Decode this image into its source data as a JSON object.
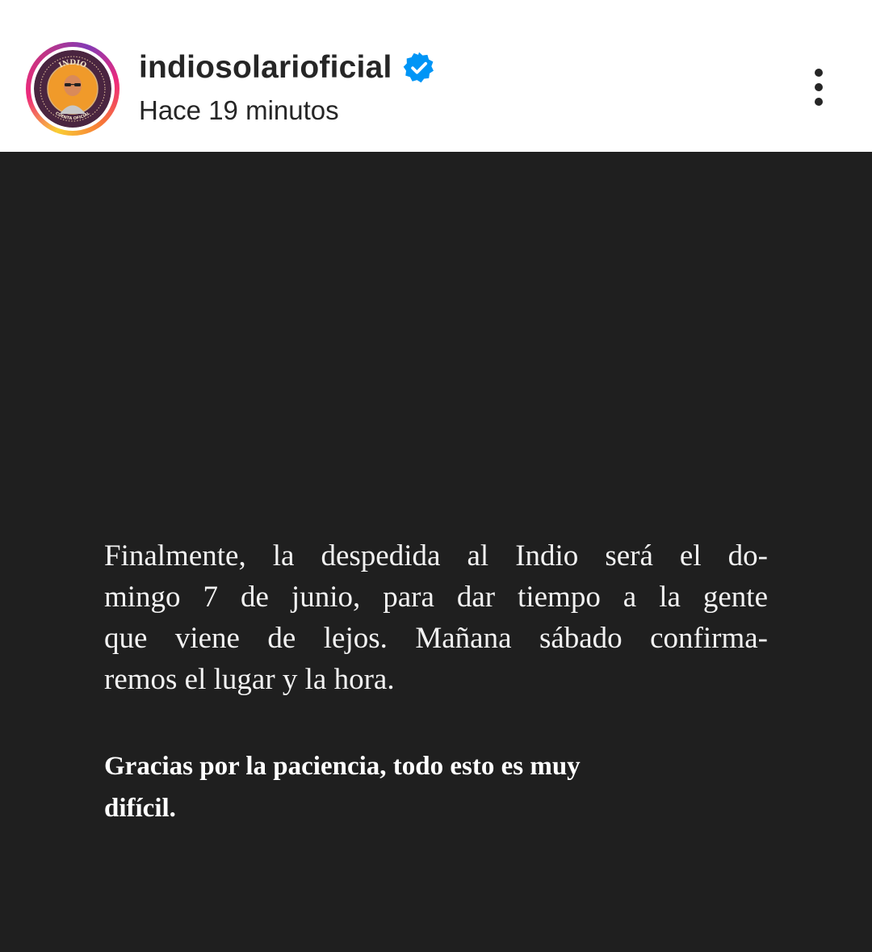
{
  "header": {
    "username": "indiosolarioficial",
    "verified": true,
    "timestamp": "Hace 19 minutos",
    "avatar": {
      "top_text": "INDIO",
      "bottom_text": "CUENTA OFICIAL"
    },
    "icons": {
      "verified": "verified-badge-icon",
      "more": "more-options-icon"
    },
    "colors": {
      "verified_badge": "#0095f6",
      "text": "#262626"
    }
  },
  "post": {
    "background": "#1f1f1f",
    "paragraph_lines": [
      "Finalmente, la despedida al Indio será el do-",
      "mingo 7 de junio, para dar tiempo a la gente",
      "que viene de lejos.  Mañana sábado confirma-",
      "remos el lugar y la hora."
    ],
    "closing_lines": [
      "Gracias por la paciencia, todo esto es muy",
      "difícil."
    ]
  }
}
